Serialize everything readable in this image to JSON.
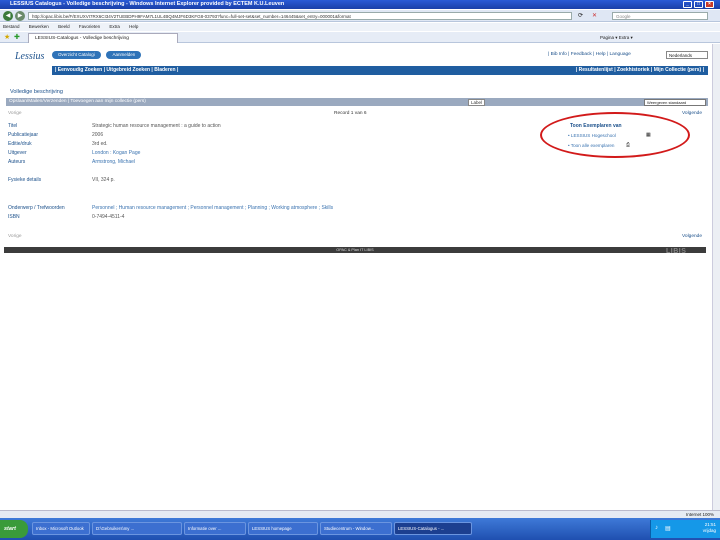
{
  "window": {
    "title": "LESSIUS Catalogus - Volledige beschrijving - Windows Internet Explorer provided by ECTEM K.U.Leuven"
  },
  "browser": {
    "url": "http://opac.libis.be/F/EXUXVI7RX6CI34V2TUEBDPH9FAM7L1UL4BQ4MJF6D3KFG8-03793?func=full-set-set&set_number=146445&set_entry=000001&format",
    "search_placeholder": "Google",
    "menu": [
      "Bestand",
      "Bewerken",
      "Beeld",
      "Favorieten",
      "Extra",
      "Help"
    ],
    "tab_label": "LESSIUS-Catalogus - Volledige beschrijving",
    "tab_tools": "Pagina ▾   Extra ▾"
  },
  "page": {
    "logo": "Lessius",
    "buttons": [
      "Overzicht Catalogi",
      "Aanmelden"
    ],
    "toplinks": "| Bib Info | Feedback | Help | Language",
    "language": "Nederlands",
    "nav_left": "| Eenvoudig Zoeken | Uitgebreid Zoeken | Bladeren |",
    "nav_right": "| Resultatenlijst | Zoekhistoriek | Mijn Collectie (pers) |",
    "heading": "Volledige beschrijving",
    "bar_text": "Opslaan/Mailen/Verzenden | Toevoegen aan mijn collectie (pers)",
    "label_tag": "Label",
    "length_select": "Weergeven standaard",
    "prev": "Vorige",
    "next": "Volgende",
    "record": "Record 1 van 6",
    "fields": [
      {
        "label": "Titel",
        "value": "Strategic human resource management : a guide to action"
      },
      {
        "label": "Publicatiejaar",
        "value": "2006"
      },
      {
        "label": "Editie/druk",
        "value": "3rd ed."
      },
      {
        "label": "Uitgever",
        "value": "London : Kogan Page"
      },
      {
        "label": "Auteurs",
        "value": "Armstrong, Michael"
      },
      {
        "label": "Fysieke details",
        "value": "VII, 324 p."
      },
      {
        "label": "Onderwerp / Trefwoorden",
        "value": "Personnel ; Human resource management ; Personnel management ; Planning ; Working atmosphere ; Skills"
      },
      {
        "label": "ISBN",
        "value": "0-7494-4511-4"
      }
    ],
    "copies_heading": "Toon Exemplaren van",
    "copies": [
      "• LESSIUS Hogeschool",
      "• Toon alle exemplaren"
    ],
    "footer": "OPAC & Plan IT LIBIS",
    "libis": "LIBIS"
  },
  "status": {
    "left": "",
    "right": "Internet   100%"
  },
  "taskbar": {
    "start": "start",
    "tasks": [
      "Inbox - Microsoft Outlook",
      "D:\\Gebruikers\\my ...",
      "Informatie over ...",
      "LESSIUS homepage",
      "Studiecentrum - Window...",
      "LESSIUS-Catalogus - ..."
    ],
    "clock_time": "21:51",
    "clock_day": "vrijdag"
  },
  "colors": {
    "accent": "#1f5da0",
    "annotation": "#d21a1a"
  }
}
